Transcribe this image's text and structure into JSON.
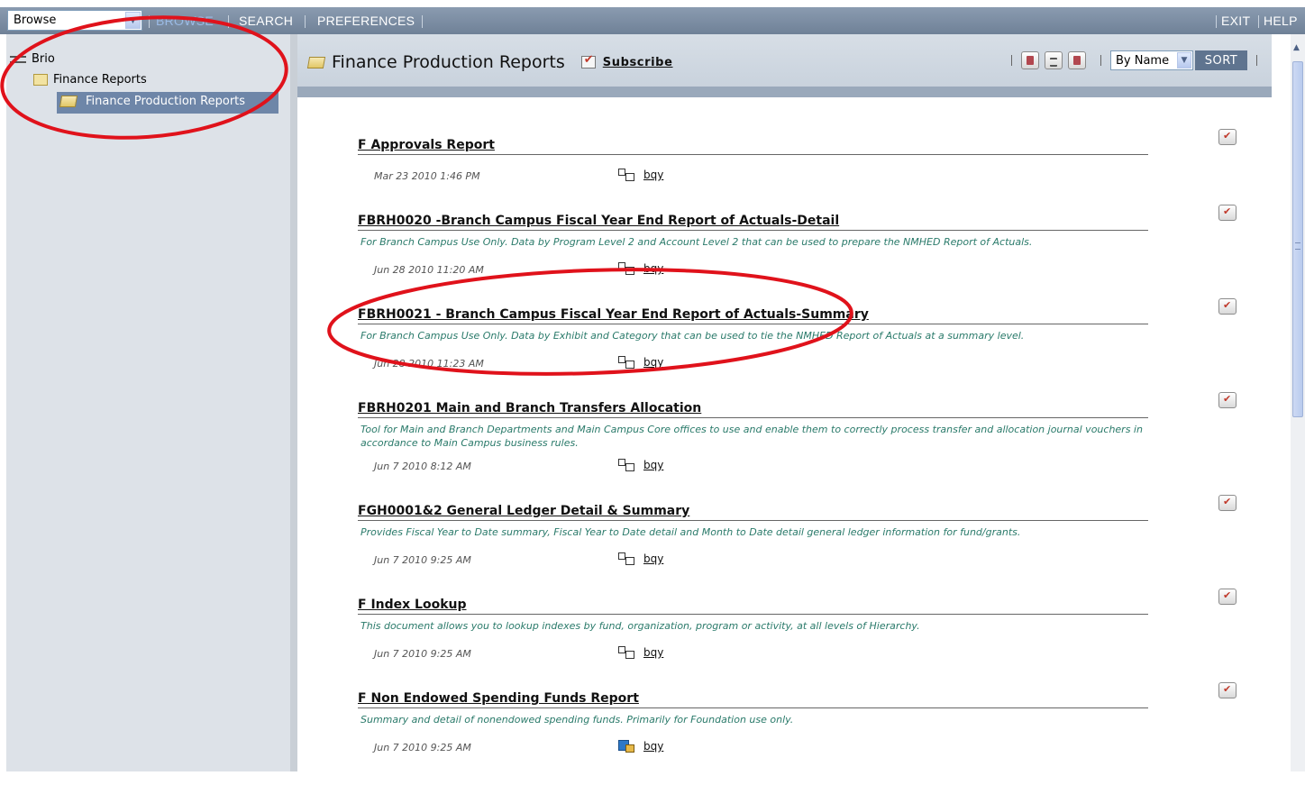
{
  "topbar": {
    "select_value": "Browse",
    "nav": [
      "BROWSE",
      "SEARCH",
      "PREFERENCES"
    ],
    "right": [
      "EXIT",
      "HELP"
    ]
  },
  "tree": {
    "root": "Brio",
    "child": "Finance Reports",
    "grandchild": "Finance Production Reports"
  },
  "header": {
    "title": "Finance Production Reports",
    "subscribe": "Subscribe",
    "sort_value": "By Name",
    "sort_button": "SORT"
  },
  "items": [
    {
      "title": "F Approvals Report",
      "desc": "",
      "date": "Mar 23 2010   1:46 PM",
      "owner": "bqy"
    },
    {
      "title": "FBRH0020 -Branch Campus Fiscal Year End Report of Actuals-Detail",
      "desc": "For Branch Campus Use Only. Data by Program Level 2 and Account Level 2 that can be used to prepare the NMHED Report of Actuals.",
      "date": "Jun 28 2010   11:20 AM",
      "owner": "bqy"
    },
    {
      "title": "FBRH0021 - Branch Campus Fiscal Year End Report of Actuals-Summary",
      "desc": "For Branch Campus Use Only. Data by Exhibit and Category that can be used to tie the NMHED Report of Actuals at a summary level.",
      "date": "Jun 28 2010   11:23 AM",
      "owner": "bqy"
    },
    {
      "title": "FBRH0201 Main and Branch Transfers Allocation",
      "desc": "Tool for Main and Branch Departments and Main Campus Core offices to use and enable them to correctly process transfer and allocation journal vouchers in accordance to Main Campus business rules.",
      "date": "Jun 7 2010   8:12 AM",
      "owner": "bqy"
    },
    {
      "title": "FGH0001&2 General Ledger Detail & Summary",
      "desc": "Provides Fiscal Year to Date summary, Fiscal Year to Date detail and Month to Date detail general ledger information for fund/grants.",
      "date": "Jun 7 2010   9:25 AM",
      "owner": "bqy"
    },
    {
      "title": "F Index Lookup",
      "desc": "This document allows you to lookup indexes by fund, organization, program or activity, at all levels of Hierarchy.",
      "date": "Jun 7 2010   9:25 AM",
      "owner": "bqy"
    },
    {
      "title": "F Non Endowed Spending Funds Report",
      "desc": "Summary and detail of nonendowed spending funds. Primarily for Foundation use only.",
      "date": "Jun 7 2010   9:25 AM",
      "owner": "bqy"
    }
  ],
  "colors": {
    "annotation": "#e0121b",
    "nav_active": "#9bbbe6",
    "desc": "#2a7a6a"
  }
}
